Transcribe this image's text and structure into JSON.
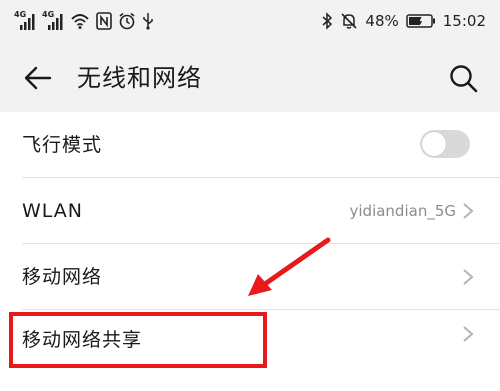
{
  "status_bar": {
    "sim1_label": "4G",
    "sim2_label": "4G",
    "icons": [
      "signal-icon",
      "signal-icon",
      "wifi-icon",
      "nfc-icon",
      "alarm-icon",
      "usb-icon",
      "bluetooth-icon",
      "mute-icon",
      "battery-icon"
    ],
    "battery_percent": "48%",
    "time": "15:02"
  },
  "toolbar": {
    "title": "无线和网络",
    "back_icon": "arrow-left-icon",
    "search_icon": "search-icon"
  },
  "settings": {
    "items": [
      {
        "label": "飞行模式",
        "control": "toggle",
        "toggle_on": false
      },
      {
        "label": "WLAN",
        "value": "yidiandian_5G",
        "control": "chevron"
      },
      {
        "label": "移动网络",
        "control": "chevron"
      },
      {
        "label": "移动网络共享",
        "control": "chevron"
      }
    ]
  },
  "annotation": {
    "color": "#e8191b",
    "highlight_target": "移动网络共享"
  }
}
